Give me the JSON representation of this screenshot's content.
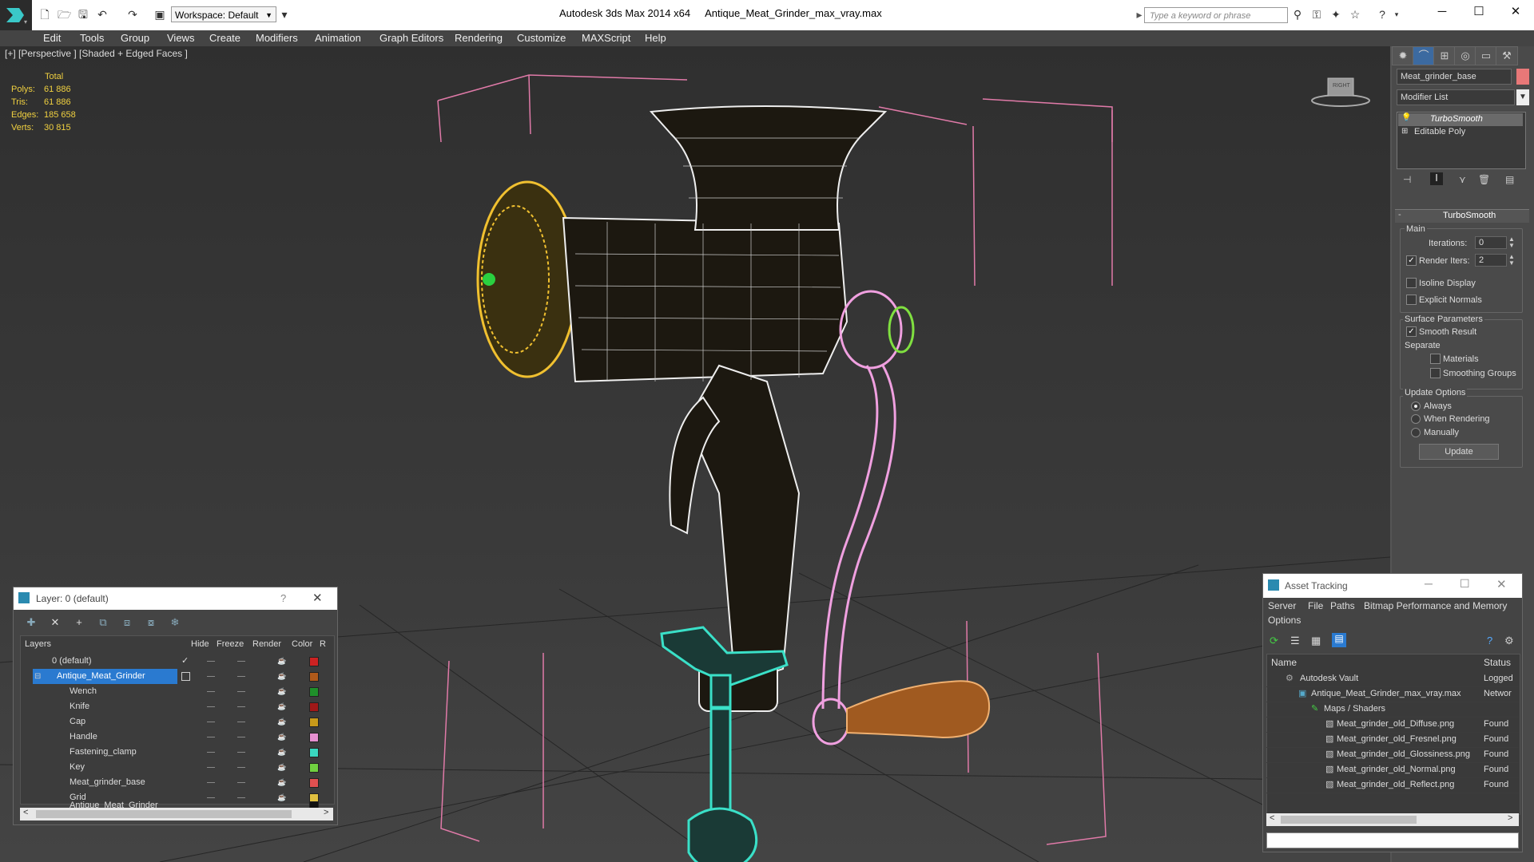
{
  "titlebar": {
    "workspace": "Workspace: Default",
    "app_title": "Autodesk 3ds Max  2014 x64",
    "file_title": "Antique_Meat_Grinder_max_vray.max",
    "search_placeholder": "Type a keyword or phrase"
  },
  "menu": [
    "Edit",
    "Tools",
    "Group",
    "Views",
    "Create",
    "Modifiers",
    "Animation",
    "Graph Editors",
    "Rendering",
    "Customize",
    "MAXScript",
    "Help"
  ],
  "viewport": {
    "label": "[+] [Perspective ] [Shaded + Edged Faces ]",
    "stats_header": "Total",
    "stats": [
      {
        "label": "Polys:",
        "value": "61 886"
      },
      {
        "label": "Tris:",
        "value": "61 886"
      },
      {
        "label": "Edges:",
        "value": "185 658"
      },
      {
        "label": "Verts:",
        "value": "30 815"
      }
    ],
    "viewcube_label": "RIGHT"
  },
  "command_panel": {
    "object_name": "Meat_grinder_base",
    "object_color": "#e87878",
    "modifier_list": "Modifier List",
    "stack": [
      "TurboSmooth",
      "Editable Poly"
    ],
    "rollout_title": "TurboSmooth",
    "main_group": "Main",
    "iterations_label": "Iterations:",
    "iterations_value": "0",
    "render_iters_label": "Render Iters:",
    "render_iters_value": "2",
    "isoline_label": "Isoline Display",
    "explicit_normals_label": "Explicit Normals",
    "surface_group": "Surface Parameters",
    "smooth_result_label": "Smooth Result",
    "separate_label": "Separate",
    "materials_label": "Materials",
    "smoothing_groups_label": "Smoothing Groups",
    "update_group": "Update Options",
    "always_label": "Always",
    "when_rendering_label": "When Rendering",
    "manually_label": "Manually",
    "update_button": "Update"
  },
  "layer_window": {
    "title": "Layer: 0 (default)",
    "help": "?",
    "columns": [
      "Layers",
      "Hide",
      "Freeze",
      "Render",
      "Color",
      "R"
    ],
    "rows": [
      {
        "name": "0 (default)",
        "color": "#cc2222",
        "level": 0,
        "checked": true
      },
      {
        "name": "Antique_Meat_Grinder",
        "color": "#b05a1a",
        "level": 0,
        "selected": true
      },
      {
        "name": "Wench",
        "color": "#1f8f2a",
        "level": 1
      },
      {
        "name": "Knife",
        "color": "#a01818",
        "level": 1
      },
      {
        "name": "Cap",
        "color": "#c89a1a",
        "level": 1
      },
      {
        "name": "Handle",
        "color": "#e690d0",
        "level": 1
      },
      {
        "name": "Fastening_clamp",
        "color": "#3ad7c0",
        "level": 1
      },
      {
        "name": "Key",
        "color": "#70d040",
        "level": 1
      },
      {
        "name": "Meat_grinder_base",
        "color": "#e05050",
        "level": 1
      },
      {
        "name": "Grid",
        "color": "#e0c040",
        "level": 1
      },
      {
        "name": "Antique_Meat_Grinder",
        "color": "#111111",
        "level": 1
      }
    ]
  },
  "asset_window": {
    "title": "Asset Tracking",
    "menu": [
      "Server",
      "File",
      "Paths",
      "Bitmap Performance and Memory",
      "Options"
    ],
    "columns": [
      "Name",
      "Status"
    ],
    "rows": [
      {
        "name": "Autodesk Vault",
        "status": "Logged",
        "level": 1
      },
      {
        "name": "Antique_Meat_Grinder_max_vray.max",
        "status": "Networ",
        "level": 2
      },
      {
        "name": "Maps / Shaders",
        "status": "",
        "level": 3
      },
      {
        "name": "Meat_grinder_old_Diffuse.png",
        "status": "Found",
        "level": 4
      },
      {
        "name": "Meat_grinder_old_Fresnel.png",
        "status": "Found",
        "level": 4
      },
      {
        "name": "Meat_grinder_old_Glossiness.png",
        "status": "Found",
        "level": 4
      },
      {
        "name": "Meat_grinder_old_Normal.png",
        "status": "Found",
        "level": 4
      },
      {
        "name": "Meat_grinder_old_Reflect.png",
        "status": "Found",
        "level": 4
      }
    ]
  }
}
